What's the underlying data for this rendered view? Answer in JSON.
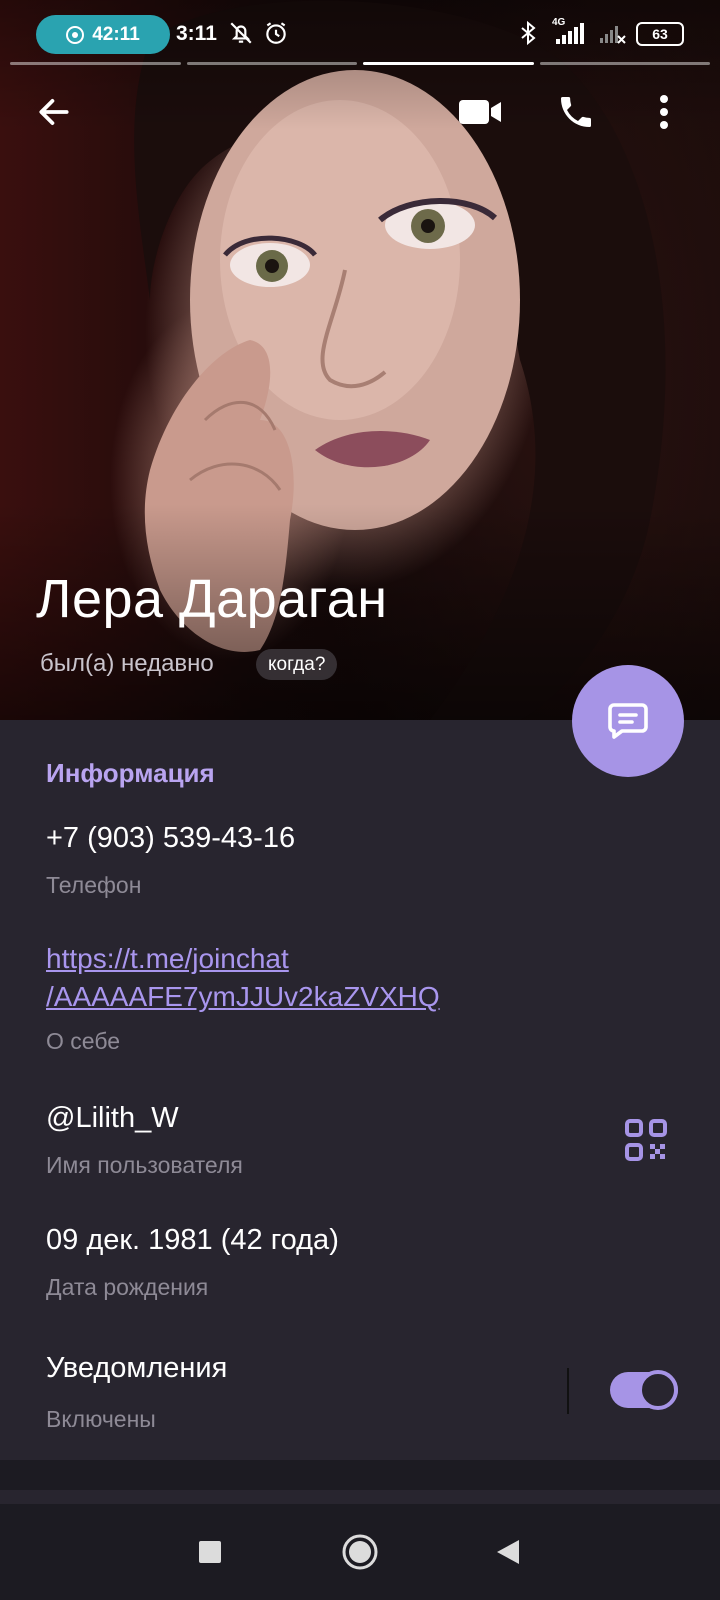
{
  "status_bar": {
    "recording_time": "42:11",
    "time": "3:11",
    "network": "4G",
    "battery": "63",
    "icons": [
      "record-icon",
      "bell-off-icon",
      "alarm-icon",
      "bluetooth-icon",
      "signal-icon",
      "signal-off-icon",
      "battery-icon"
    ]
  },
  "toolbar": {
    "icons": [
      "back-arrow-icon",
      "video-call-icon",
      "phone-icon",
      "more-vert-icon"
    ]
  },
  "profile": {
    "name": "Лера Дараган",
    "last_seen": "был(а) недавно",
    "when_chip": "когда?"
  },
  "info": {
    "section_title": "Информация",
    "phone": {
      "value": "+7 (903) 539-43-16",
      "label": "Телефон"
    },
    "bio": {
      "line1": "https://t.me/joinchat",
      "line2": "/AAAAAFE7ymJJUv2kaZVXHQ",
      "label": "О себе"
    },
    "username": {
      "value": "@Lilith_W",
      "label": "Имя пользователя"
    },
    "birthday": {
      "value": "09 дек. 1981 (42 года)",
      "label": "Дата рождения"
    },
    "notifications": {
      "value": "Уведомления",
      "label": "Включены",
      "enabled": true
    }
  },
  "colors": {
    "accent": "#a694e6",
    "section_title": "#b9a4f0",
    "link": "#a996ee",
    "card_bg": "#28252f",
    "page_bg": "#1c1b22",
    "rec_pill": "#2aa3b0"
  },
  "navbar": {
    "icons": [
      "recents-square-icon",
      "home-circle-icon",
      "back-triangle-icon"
    ]
  }
}
